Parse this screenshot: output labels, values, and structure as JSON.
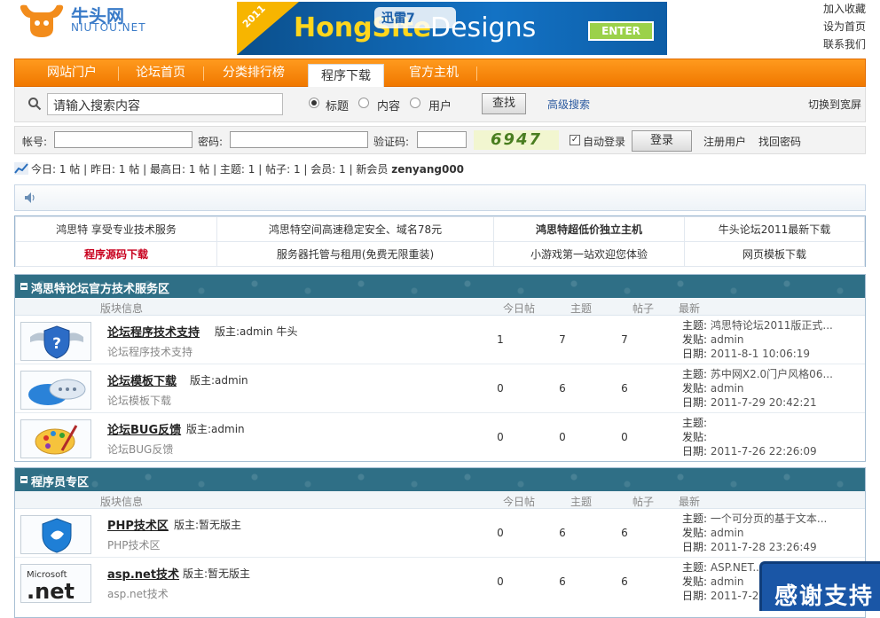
{
  "header": {
    "logo_cn": "牛头网",
    "logo_en": "NIUTOU.NET",
    "banner": {
      "ribbon": "2011",
      "title_a": "HongSite",
      "title_b": "Designs",
      "badge": "迅雷7",
      "enter": "ENTER"
    },
    "top_links": [
      "加入收藏",
      "设为首页",
      "联系我们"
    ]
  },
  "nav": {
    "items": [
      "网站门户",
      "论坛首页",
      "分类排行榜",
      "程序下载",
      "官方主机"
    ],
    "active_index": 3
  },
  "search": {
    "placeholder": "请输入搜索内容",
    "options": [
      "标题",
      "内容",
      "用户"
    ],
    "selected": "标题",
    "button": "查找",
    "advanced": "高级搜索",
    "switch_wide": "切换到宽屏"
  },
  "login": {
    "account_label": "帐号:",
    "password_label": "密码:",
    "captcha_label": "验证码:",
    "captcha_code": "6947",
    "auto_login": "自动登录",
    "auto_login_checked": true,
    "login_button": "登录",
    "register": "注册用户",
    "recover": "找回密码"
  },
  "stats": {
    "text": "今日: 1 帖  |  昨日: 1 帖  |  最高日: 1 帖  |  主题: 1  |  帖子: 1  |  会员: 1  |  新会员",
    "new_member": "zenyang000"
  },
  "ads": {
    "rows": [
      [
        "鸿思特 享受专业技术服务",
        "鸿思特空间高速稳定安全、域名78元",
        "鸿思特超低价独立主机",
        "牛头论坛2011最新下载"
      ],
      [
        "程序源码下载",
        "服务器托管与租用(免费无限重装)",
        "小游戏第一站欢迎您体验",
        "网页模板下载"
      ]
    ]
  },
  "columns": {
    "info": "版块信息",
    "today": "今日帖",
    "topics": "主题",
    "posts": "帖子",
    "latest": "最新"
  },
  "last_labels": {
    "topic": "主题:",
    "poster": "发贴:",
    "date": "日期:"
  },
  "sections": [
    {
      "title": "鸿思特论坛官方技术服务区",
      "forums": [
        {
          "icon": "shield-question-icon",
          "name": "论坛程序技术支持",
          "moderator": "版主:admin  牛头",
          "desc": "论坛程序技术支持",
          "today": "1",
          "topics": "7",
          "posts": "7",
          "last_topic": "鸿思特论坛2011版正式...",
          "last_poster": "admin",
          "last_date": "2011-8-1 10:06:19"
        },
        {
          "icon": "chat-cloud-icon",
          "name": "论坛模板下载",
          "moderator": "版主:admin",
          "desc": "论坛模板下载",
          "today": "0",
          "topics": "6",
          "posts": "6",
          "last_topic": "苏中网X2.0门户风格06...",
          "last_poster": "admin",
          "last_date": "2011-7-29 20:42:21"
        },
        {
          "icon": "paint-palette-icon",
          "name": "论坛BUG反馈",
          "moderator": "版主:admin",
          "desc": "论坛BUG反馈",
          "today": "0",
          "topics": "0",
          "posts": "0",
          "last_topic": "",
          "last_poster": "",
          "last_date": "2011-7-26 22:26:09"
        }
      ]
    },
    {
      "title": "程序员专区",
      "forums": [
        {
          "icon": "blue-shield-icon",
          "name": "PHP技术区",
          "moderator": "版主:暂无版主",
          "desc": "PHP技术区",
          "today": "0",
          "topics": "6",
          "posts": "6",
          "last_topic": "一个可分页的基于文本...",
          "last_poster": "admin",
          "last_date": "2011-7-28 23:26:49"
        },
        {
          "icon": "dotnet-logo-icon",
          "name": "asp.net技术",
          "moderator": "版主:暂无版主",
          "desc": "asp.net技术",
          "today": "0",
          "topics": "6",
          "posts": "6",
          "last_topic": "ASP.NET...",
          "last_poster": "admin",
          "last_date": "2011-7-2..."
        }
      ]
    }
  ],
  "float_banner": "感谢支持",
  "colors": {
    "nav": "#f07800",
    "section_head": "#2f6f86",
    "ad_red": "#c8001e"
  }
}
